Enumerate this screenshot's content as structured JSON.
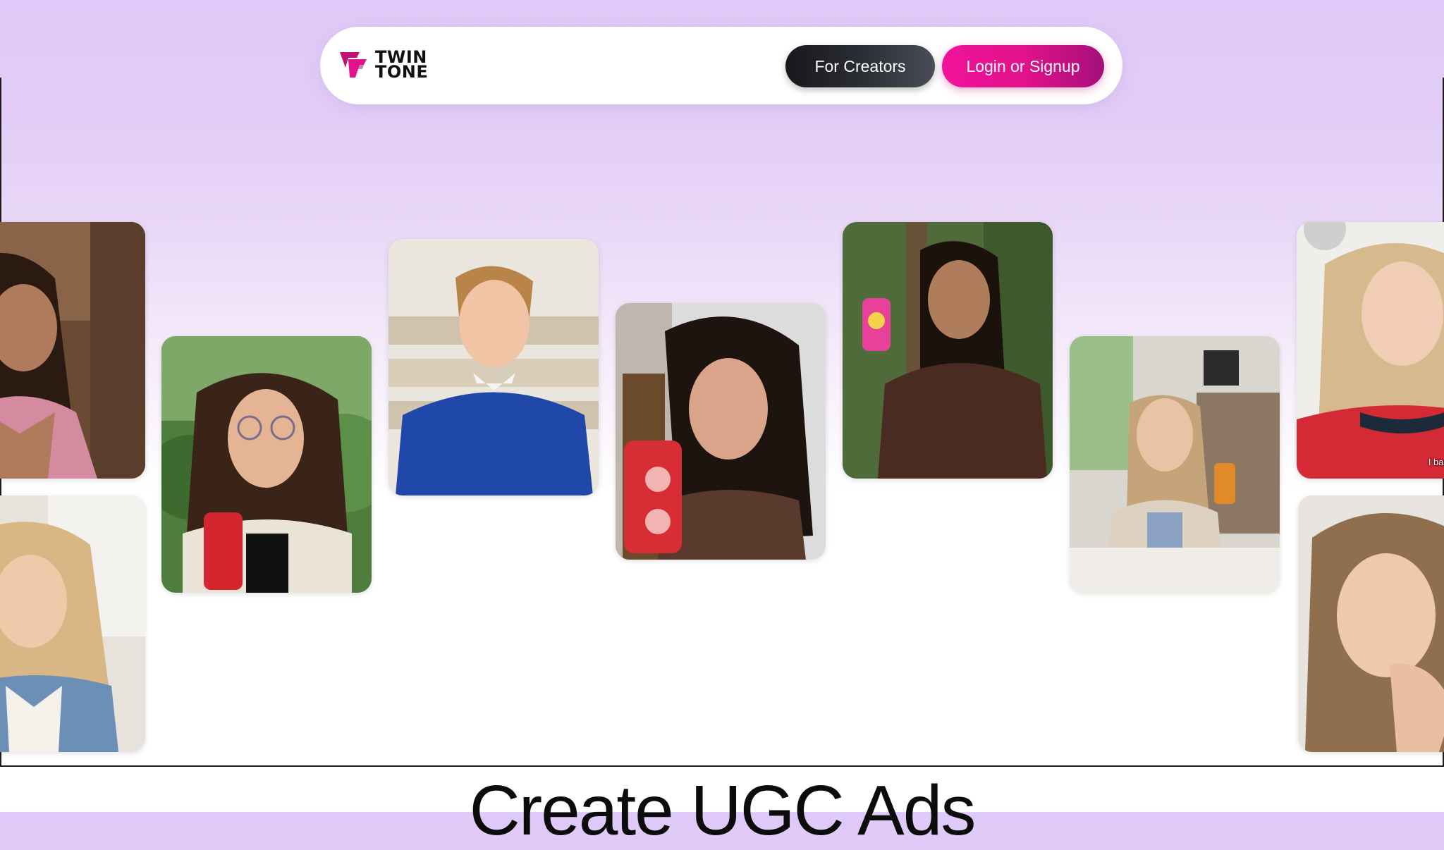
{
  "brand": {
    "line1": "TWIN",
    "line2": "TONE",
    "logo_icon": "twin-tone-logo-icon",
    "accent": "#e3118c"
  },
  "nav": {
    "creators_label": "For Creators",
    "login_label": "Login or Signup"
  },
  "gallery": {
    "cards": [
      {
        "label": "creator-woman-plaid-top"
      },
      {
        "label": "creator-woman-blonde-denim"
      },
      {
        "label": "creator-woman-glasses-soda-can"
      },
      {
        "label": "creator-man-blue-sweater"
      },
      {
        "label": "creator-woman-red-soda-can"
      },
      {
        "label": "creator-woman-brown-jacket-pink-can"
      },
      {
        "label": "creator-woman-living-room-orange-can"
      },
      {
        "label": "creator-woman-red-shirt"
      },
      {
        "label": "creator-woman-hand-on-chin"
      }
    ],
    "caption": "I basically made an"
  },
  "hero": {
    "headline": "Create UGC Ads"
  }
}
